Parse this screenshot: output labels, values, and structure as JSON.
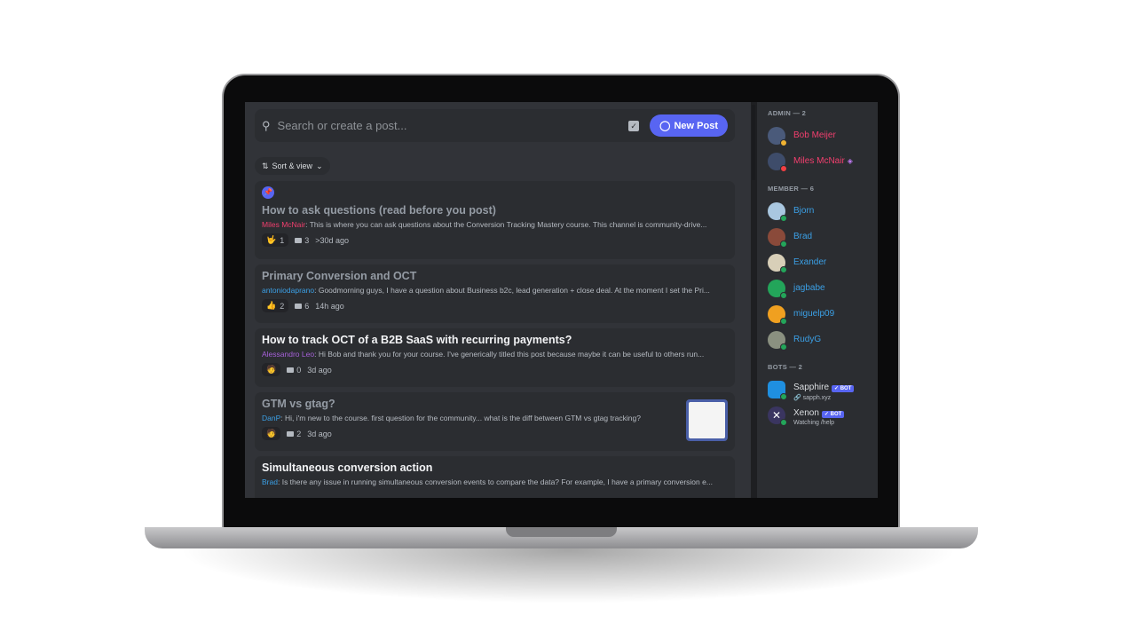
{
  "search": {
    "placeholder": "Search or create a post...",
    "new_post_label": "New Post"
  },
  "sort": {
    "label": "Sort & view"
  },
  "posts": [
    {
      "title": "How to ask questions (read before you post)",
      "author": "Miles McNair",
      "author_color": "#f23f6e",
      "snippet": "This is where you can ask questions about the Conversion Tracking Mastery course. This channel is community-drive...",
      "reaction": "🤟",
      "reaction_count": "1",
      "comments": "3",
      "time": ">30d ago",
      "pinned": true,
      "unread": false
    },
    {
      "title": "Primary Conversion and OCT",
      "author": "antoniodaprano",
      "author_color": "#3ba0e6",
      "snippet": "Goodmorning guys, I have a question about Business b2c, lead generation + close deal. At the moment I set the Pri...",
      "reaction": "👍",
      "reaction_count": "2",
      "comments": "6",
      "time": "14h ago",
      "unread": false
    },
    {
      "title": "How to track OCT of a B2B SaaS with recurring payments?",
      "author": "Alessandro Leo",
      "author_color": "#a560d8",
      "snippet": "Hi Bob and thank you for your course. I've generically titled this post because maybe it can be useful to others run...",
      "reaction": "🧑",
      "comments": "0",
      "time": "3d ago",
      "unread": true
    },
    {
      "title": "GTM vs gtag?",
      "author": "DanP",
      "author_color": "#3ba0e6",
      "snippet": "Hi, i'm new to the course. first question for the community... what is the diff between GTM vs gtag tracking?",
      "reaction": "🧑",
      "comments": "2",
      "time": "3d ago",
      "unread": false
    },
    {
      "title": "Simultaneous conversion action",
      "author": "Brad",
      "author_color": "#3ba0e6",
      "snippet": "Is there any issue in running simultaneous conversion events to compare the data? For example, I have a primary conversion e...",
      "unread": true
    }
  ],
  "members": {
    "admin_header": "ADMIN — 2",
    "admins": [
      {
        "name": "Bob Meijer",
        "color": "#f23f6e"
      },
      {
        "name": "Miles McNair",
        "color": "#f23f6e"
      }
    ],
    "member_header": "MEMBER — 6",
    "members": [
      {
        "name": "Bjorn"
      },
      {
        "name": "Brad"
      },
      {
        "name": "Exander"
      },
      {
        "name": "jagbabe"
      },
      {
        "name": "miguelp09"
      },
      {
        "name": "RudyG"
      }
    ],
    "bots_header": "BOTS — 2",
    "bots": [
      {
        "name": "Sapphire",
        "badge": "✓ BOT",
        "status": "🔗 sapph.xyz"
      },
      {
        "name": "Xenon",
        "badge": "✓ BOT",
        "status": "Watching /help"
      }
    ]
  }
}
